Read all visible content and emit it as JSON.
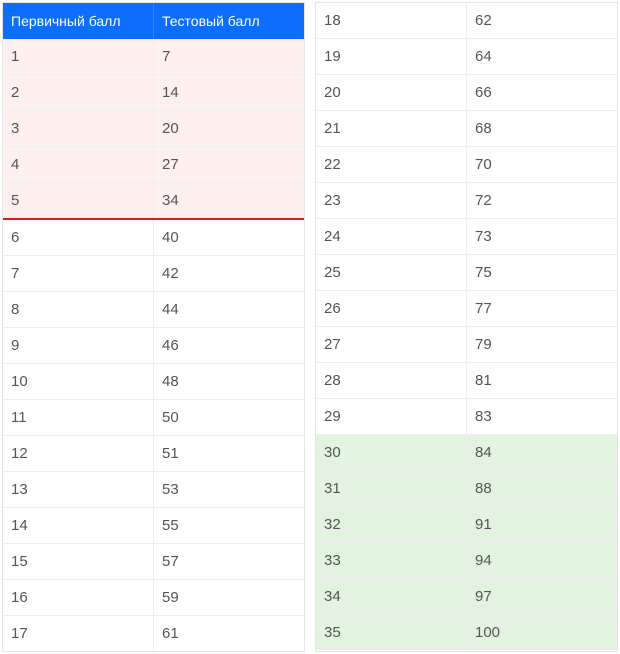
{
  "header": {
    "col1": "Первичный балл",
    "col2": "Тестовый балл"
  },
  "left": [
    {
      "p": "1",
      "t": "7",
      "cls": "highlight-pink"
    },
    {
      "p": "2",
      "t": "14",
      "cls": "highlight-pink"
    },
    {
      "p": "3",
      "t": "20",
      "cls": "highlight-pink"
    },
    {
      "p": "4",
      "t": "27",
      "cls": "highlight-pink"
    },
    {
      "p": "5",
      "t": "34",
      "cls": "highlight-pink last-pink"
    },
    {
      "p": "6",
      "t": "40",
      "cls": ""
    },
    {
      "p": "7",
      "t": "42",
      "cls": ""
    },
    {
      "p": "8",
      "t": "44",
      "cls": ""
    },
    {
      "p": "9",
      "t": "46",
      "cls": ""
    },
    {
      "p": "10",
      "t": "48",
      "cls": ""
    },
    {
      "p": "11",
      "t": "50",
      "cls": ""
    },
    {
      "p": "12",
      "t": "51",
      "cls": ""
    },
    {
      "p": "13",
      "t": "53",
      "cls": ""
    },
    {
      "p": "14",
      "t": "55",
      "cls": ""
    },
    {
      "p": "15",
      "t": "57",
      "cls": ""
    },
    {
      "p": "16",
      "t": "59",
      "cls": ""
    },
    {
      "p": "17",
      "t": "61",
      "cls": ""
    }
  ],
  "right": [
    {
      "p": "18",
      "t": "62",
      "cls": ""
    },
    {
      "p": "19",
      "t": "64",
      "cls": ""
    },
    {
      "p": "20",
      "t": "66",
      "cls": ""
    },
    {
      "p": "21",
      "t": "68",
      "cls": ""
    },
    {
      "p": "22",
      "t": "70",
      "cls": ""
    },
    {
      "p": "23",
      "t": "72",
      "cls": ""
    },
    {
      "p": "24",
      "t": "73",
      "cls": ""
    },
    {
      "p": "25",
      "t": "75",
      "cls": ""
    },
    {
      "p": "26",
      "t": "77",
      "cls": ""
    },
    {
      "p": "27",
      "t": "79",
      "cls": ""
    },
    {
      "p": "28",
      "t": "81",
      "cls": ""
    },
    {
      "p": "29",
      "t": "83",
      "cls": ""
    },
    {
      "p": "30",
      "t": "84",
      "cls": "highlight-green"
    },
    {
      "p": "31",
      "t": "88",
      "cls": "highlight-green"
    },
    {
      "p": "32",
      "t": "91",
      "cls": "highlight-green"
    },
    {
      "p": "33",
      "t": "94",
      "cls": "highlight-green"
    },
    {
      "p": "34",
      "t": "97",
      "cls": "highlight-green"
    },
    {
      "p": "35",
      "t": "100",
      "cls": "highlight-green"
    }
  ]
}
